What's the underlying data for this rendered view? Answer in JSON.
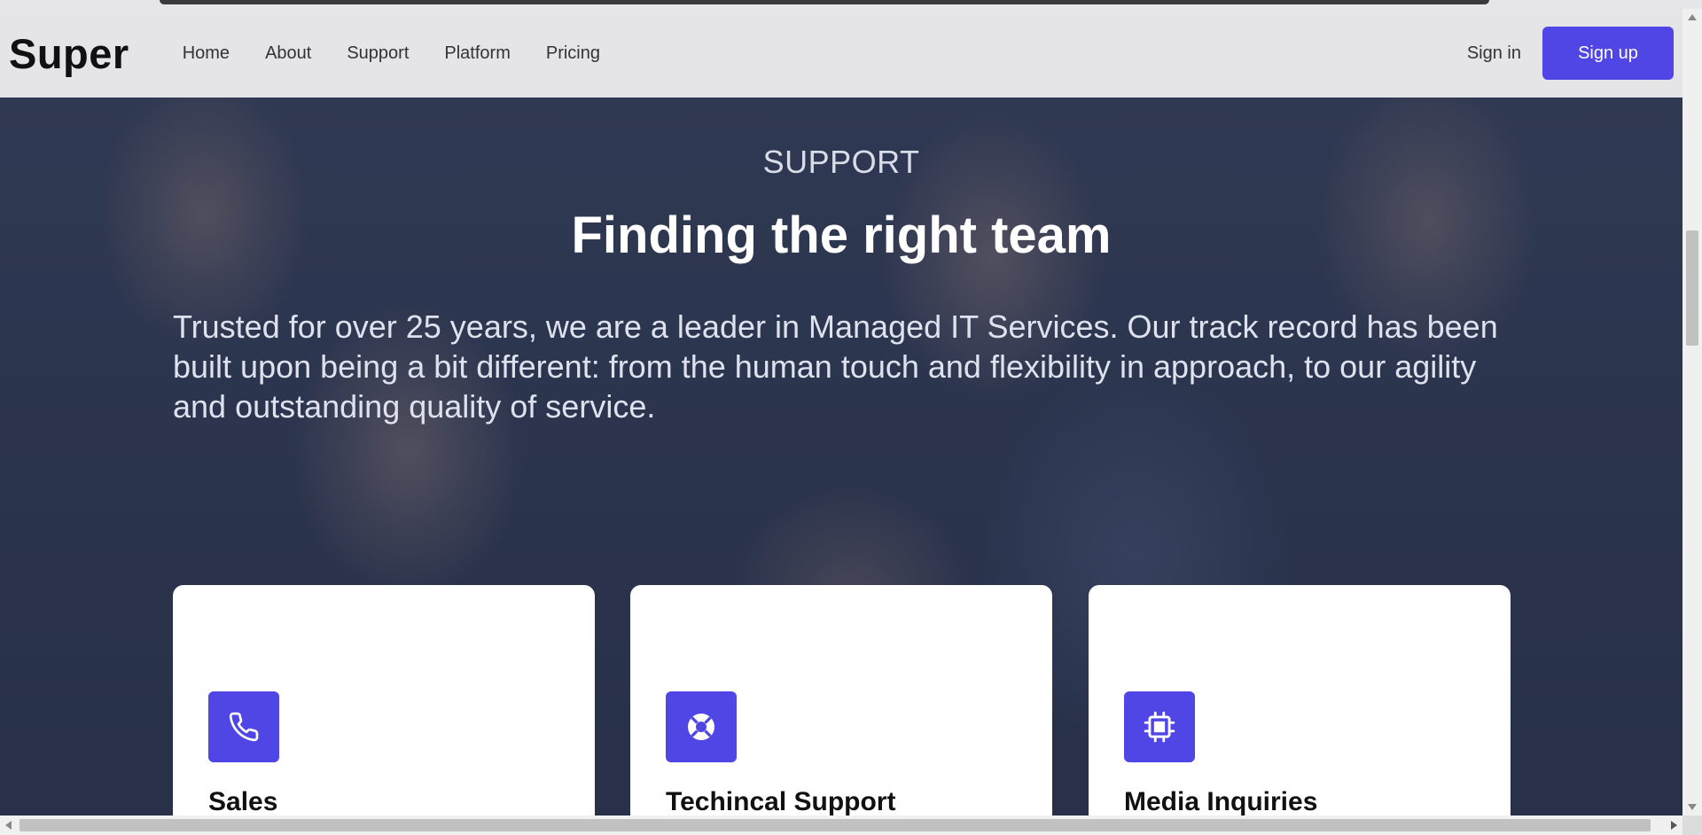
{
  "navbar": {
    "logo": "Super",
    "links": [
      "Home",
      "About",
      "Support",
      "Platform",
      "Pricing"
    ],
    "signin_label": "Sign in",
    "signup_label": "Sign up"
  },
  "hero": {
    "eyebrow": "SUPPORT",
    "title": "Finding the right team",
    "description": "Trusted for over 25 years, we are a leader in Managed IT Services. Our track record has been built upon being a bit different: from the human touch and flexibility in approach, to our agility and outstanding quality of service."
  },
  "cards": [
    {
      "title": "Sales",
      "icon": "phone-icon"
    },
    {
      "title": "Techincal Support",
      "icon": "lifebuoy-icon"
    },
    {
      "title": "Media Inquiries",
      "icon": "chip-icon"
    }
  ],
  "colors": {
    "accent": "#4f46e5",
    "navbar_bg": "#e5e5e8",
    "card_bg": "#ffffff"
  }
}
